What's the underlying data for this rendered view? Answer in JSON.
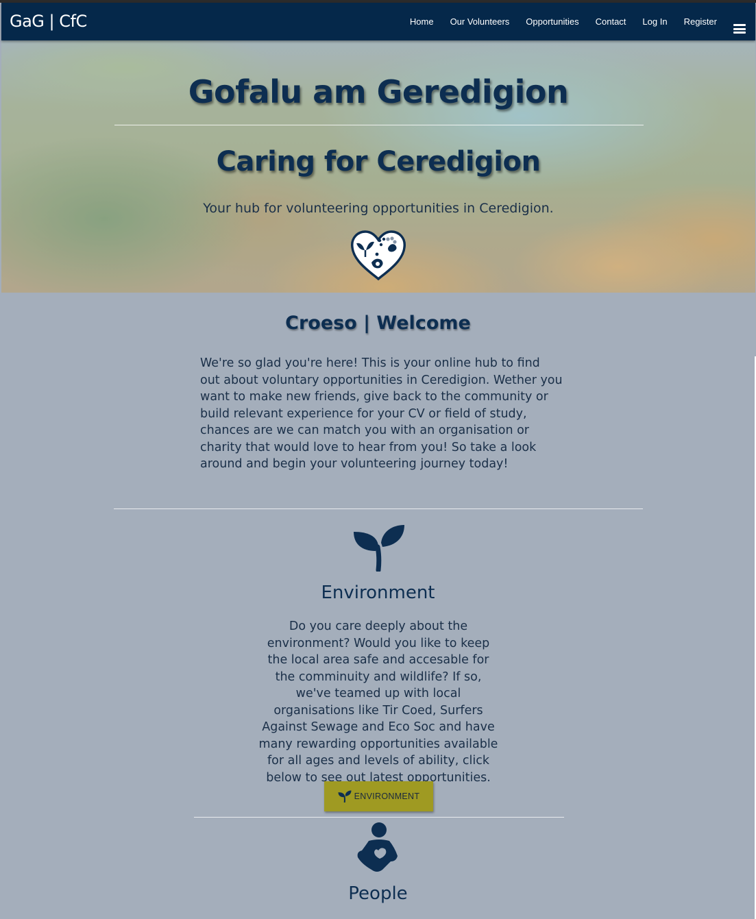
{
  "navbar": {
    "brand": "GaG | CfC",
    "links": [
      "Home",
      "Our Volunteers",
      "Opportunities",
      "Contact",
      "Log In",
      "Register"
    ],
    "menu_icon": "hamburger-menu-icon"
  },
  "hero": {
    "title": "Gofalu am Geredigion",
    "subtitle": "Caring for Ceredigion",
    "tagline": "Your hub for volunteering opportunities in Ceredigion.",
    "logo_icon": "heart-paw-leaf-icon"
  },
  "welcome": {
    "title": "Croeso | Welcome",
    "text": "We're so glad you're here! This is your online hub to find out about voluntary opportunities in Ceredigion. Wether you want to make new friends, give back to the community or build relevant experience for your CV or field of study, chances are we can match you with an organisation or charity that would love to hear from you! So take a look around and begin your volunteering journey today!"
  },
  "environment": {
    "icon": "seedling-icon",
    "title": "Environment",
    "text": "Do you care deeply about the environment? Would you like to keep the local area safe and accesable for the comminuity and wildlife? If so, we've teamed up with local organisations like Tir Coed, Surfers Against Sewage and Eco Soc and have many rewarding opportunities available for all ages and levels of ability, click below to see out latest opportunities.",
    "button_label": "ENVIRONMENT",
    "button_color": "#9f9a22"
  },
  "people": {
    "icon": "person-holding-heart-icon",
    "title": "People"
  },
  "colors": {
    "navbar": "#05284a",
    "heading": "#0d2e51",
    "background": "#a4aebb"
  }
}
